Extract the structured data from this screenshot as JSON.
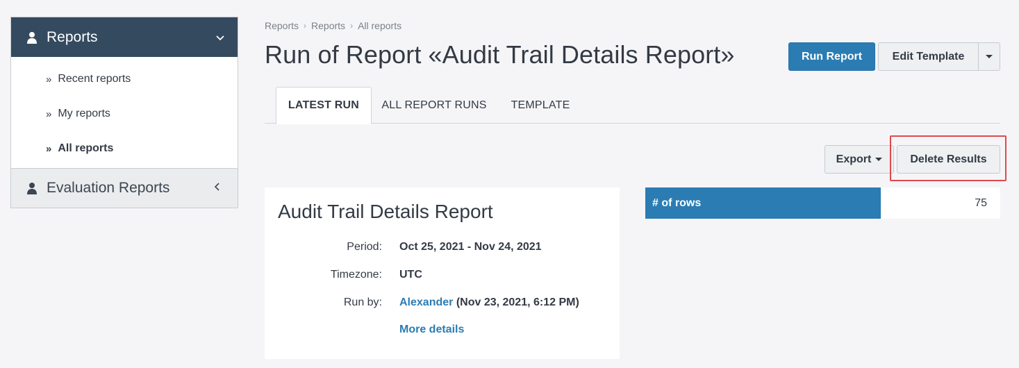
{
  "sidebar": {
    "header": {
      "title": "Reports",
      "icon": "person-icon"
    },
    "items": [
      {
        "label": "Recent reports",
        "active": false
      },
      {
        "label": "My reports",
        "active": false
      },
      {
        "label": "All reports",
        "active": true
      }
    ],
    "footer": {
      "title": "Evaluation Reports",
      "icon": "person-icon"
    }
  },
  "breadcrumb": [
    "Reports",
    "Reports",
    "All reports"
  ],
  "page": {
    "title": "Run of Report «Audit Trail Details Report»"
  },
  "header_actions": {
    "run_label": "Run Report",
    "edit_label": "Edit Template"
  },
  "tabs": [
    {
      "label": "LATEST RUN",
      "active": true
    },
    {
      "label": "ALL REPORT RUNS",
      "active": false
    },
    {
      "label": "TEMPLATE",
      "active": false
    }
  ],
  "actions": {
    "export_label": "Export",
    "delete_label": "Delete Results"
  },
  "report": {
    "title": "Audit Trail Details Report",
    "period_label": "Period:",
    "period_value": "Oct 25, 2021 - Nov 24, 2021",
    "timezone_label": "Timezone:",
    "timezone_value": "UTC",
    "runby_label": "Run by:",
    "runby_user": "Alexander",
    "runby_time": " (Nov 23, 2021, 6:12 PM)",
    "more_details": "More details"
  },
  "stats": {
    "rows_label": "# of rows",
    "rows_value": "75"
  },
  "colors": {
    "sidebar_header": "#344a5f",
    "primary": "#2b7cb3",
    "highlight": "#e0474c"
  }
}
